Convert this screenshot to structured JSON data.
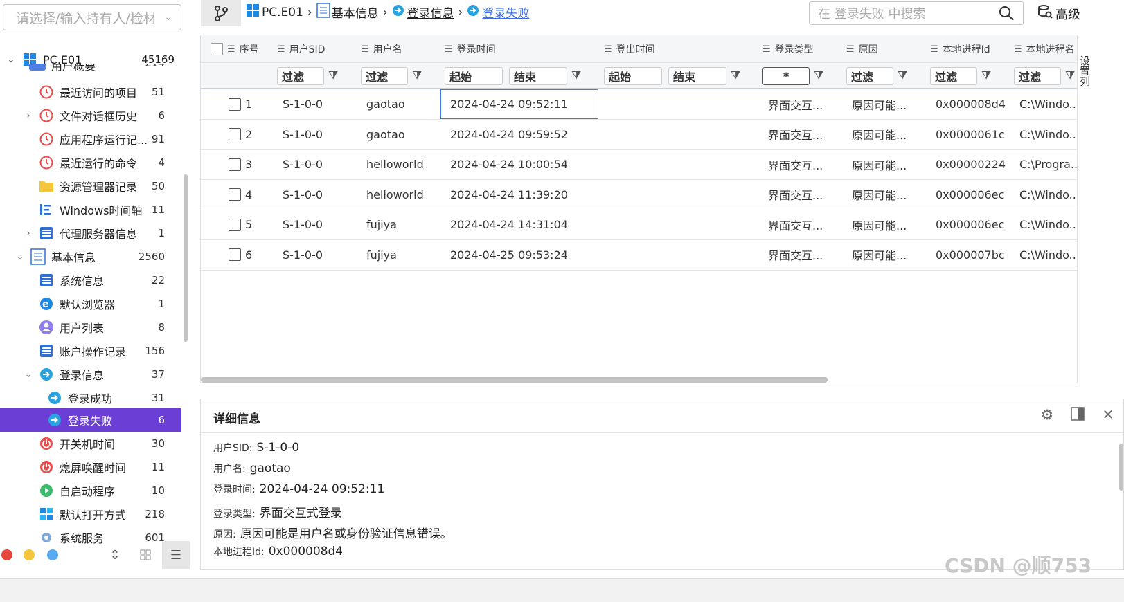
{
  "left_panel": {
    "combo_placeholder": "请选择/输入持有人/检材",
    "root": {
      "label": "PC.E01",
      "count": "45169"
    },
    "partial_item": {
      "label": "用户概要",
      "count": "214"
    },
    "items": [
      {
        "label": "最近访问的项目",
        "count": "51",
        "icon": "history-icon",
        "level": 2,
        "expander": ""
      },
      {
        "label": "文件对话框历史",
        "count": "6",
        "icon": "history-icon",
        "level": 2,
        "expander": "›"
      },
      {
        "label": "应用程序运行记...",
        "count": "91",
        "icon": "history-icon",
        "level": 2,
        "expander": ""
      },
      {
        "label": "最近运行的命令",
        "count": "4",
        "icon": "history-icon",
        "level": 2,
        "expander": ""
      },
      {
        "label": "资源管理器记录",
        "count": "50",
        "icon": "folder-icon",
        "level": 2,
        "expander": ""
      },
      {
        "label": "Windows时间轴",
        "count": "11",
        "icon": "timeline-icon",
        "level": 2,
        "expander": ""
      },
      {
        "label": "代理服务器信息",
        "count": "1",
        "icon": "list-icon",
        "level": 2,
        "expander": "›"
      },
      {
        "label": "基本信息",
        "count": "2560",
        "icon": "info-list-icon",
        "level": 1,
        "expander": "⌄"
      },
      {
        "label": "系统信息",
        "count": "22",
        "icon": "list-icon",
        "level": 2,
        "expander": ""
      },
      {
        "label": "默认浏览器",
        "count": "1",
        "icon": "browser-icon",
        "level": 2,
        "expander": ""
      },
      {
        "label": "用户列表",
        "count": "8",
        "icon": "user-icon",
        "level": 2,
        "expander": ""
      },
      {
        "label": "账户操作记录",
        "count": "156",
        "icon": "list-icon",
        "level": 2,
        "expander": ""
      },
      {
        "label": "登录信息",
        "count": "37",
        "icon": "login-icon",
        "level": 2,
        "expander": "⌄"
      },
      {
        "label": "登录成功",
        "count": "31",
        "icon": "login-icon",
        "level": 3,
        "expander": ""
      },
      {
        "label": "登录失败",
        "count": "6",
        "icon": "login-icon",
        "level": 3,
        "expander": "",
        "selected": true
      },
      {
        "label": "开关机时间",
        "count": "30",
        "icon": "power-icon",
        "level": 2,
        "expander": ""
      },
      {
        "label": "熄屏唤醒时间",
        "count": "11",
        "icon": "power-icon",
        "level": 2,
        "expander": ""
      },
      {
        "label": "自启动程序",
        "count": "10",
        "icon": "play-icon",
        "level": 2,
        "expander": ""
      },
      {
        "label": "默认打开方式",
        "count": "218",
        "icon": "apps-icon",
        "level": 2,
        "expander": ""
      },
      {
        "label": "系统服务",
        "count": "601",
        "icon": "gear-icon",
        "level": 2,
        "expander": ""
      }
    ]
  },
  "breadcrumb": {
    "root": "PC.E01",
    "c1": "基本信息",
    "c2": "登录信息",
    "c3": "登录失败",
    "sep": "›"
  },
  "search": {
    "placeholder": "在 登录失败 中搜索"
  },
  "advanced_label": "高级",
  "columns": [
    "序号",
    "用户SID",
    "用户名",
    "登录时间",
    "登出时间",
    "登录类型",
    "原因",
    "本地进程Id",
    "本地进程名"
  ],
  "filters": {
    "sid": "过滤",
    "user": "过滤",
    "login_start": "起始",
    "login_end": "结束",
    "logout_start": "起始",
    "logout_end": "结束",
    "type": "*",
    "reason": "过滤",
    "pid": "过滤",
    "pname": "过滤"
  },
  "rows": [
    {
      "idx": "1",
      "sid": "S-1-0-0",
      "user": "gaotao",
      "login": "2024-04-24 09:52:11",
      "logout": "",
      "type": "界面交互...",
      "reason": "原因可能...",
      "pid": "0x000008d4",
      "pname": "C:\\Windo..."
    },
    {
      "idx": "2",
      "sid": "S-1-0-0",
      "user": "gaotao",
      "login": "2024-04-24 09:59:52",
      "logout": "",
      "type": "界面交互...",
      "reason": "原因可能...",
      "pid": "0x0000061c",
      "pname": "C:\\Windo..."
    },
    {
      "idx": "3",
      "sid": "S-1-0-0",
      "user": "helloworld",
      "login": "2024-04-24 10:00:54",
      "logout": "",
      "type": "界面交互...",
      "reason": "原因可能...",
      "pid": "0x00000224",
      "pname": "C:\\Progra..."
    },
    {
      "idx": "4",
      "sid": "S-1-0-0",
      "user": "helloworld",
      "login": "2024-04-24 11:39:20",
      "logout": "",
      "type": "界面交互...",
      "reason": "原因可能...",
      "pid": "0x000006ec",
      "pname": "C:\\Windo..."
    },
    {
      "idx": "5",
      "sid": "S-1-0-0",
      "user": "fujiya",
      "login": "2024-04-24 14:31:04",
      "logout": "",
      "type": "界面交互...",
      "reason": "原因可能...",
      "pid": "0x000006ec",
      "pname": "C:\\Windo..."
    },
    {
      "idx": "6",
      "sid": "S-1-0-0",
      "user": "fujiya",
      "login": "2024-04-25 09:53:24",
      "logout": "",
      "type": "界面交互...",
      "reason": "原因可能...",
      "pid": "0x000007bc",
      "pname": "C:\\Windo..."
    }
  ],
  "side_strip": "设置列",
  "detail": {
    "title": "详细信息",
    "fields": [
      {
        "label": "用户SID:",
        "value": "S-1-0-0"
      },
      {
        "label": "用户名:",
        "value": "gaotao"
      },
      {
        "label": "登录时间:",
        "value": "2024-04-24 09:52:11"
      },
      {
        "label": "登录类型:",
        "value": "界面交互式登录"
      },
      {
        "label": "原因:",
        "value": "原因可能是用户名或身份验证信息错误。"
      },
      {
        "label": "本地进程Id:",
        "value": "0x000008d4"
      }
    ]
  },
  "watermark": "CSDN @顺753",
  "colors": {
    "selected": "#6b3fd6",
    "link": "#3b6fe8",
    "dot_red": "#e8453c",
    "dot_yellow": "#f5c63b",
    "dot_blue": "#5aaaf0"
  }
}
